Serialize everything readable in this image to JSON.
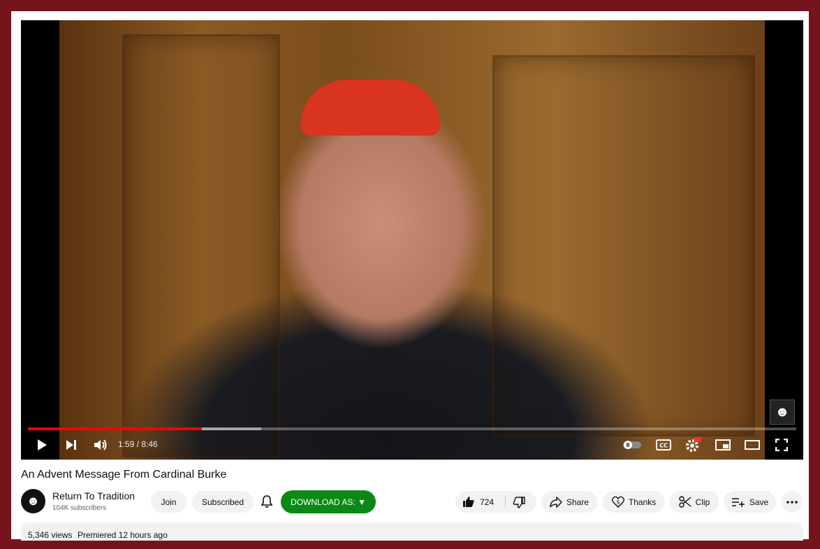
{
  "video": {
    "current_time": "1:59",
    "duration": "8:46",
    "time_display": "1:59 / 8:46",
    "progress_fraction": 0.226,
    "buffered_fraction": 0.304
  },
  "title": "An Advent Message From Cardinal Burke",
  "channel": {
    "name": "Return To Tradition",
    "subscribers": "104K subscribers"
  },
  "buttons": {
    "join": "Join",
    "subscribed": "Subscribed",
    "download": "DOWNLOAD AS: ▼",
    "likes": "724",
    "share": "Share",
    "thanks": "Thanks",
    "clip": "Clip",
    "save": "Save"
  },
  "description": {
    "views": "5,346 views",
    "premiered": "Premiered 12 hours ago"
  },
  "colors": {
    "frame": "#76141d",
    "progress": "#ff0000",
    "download": "#0a8a14"
  },
  "icons": [
    "play-icon",
    "next-icon",
    "volume-icon",
    "autoplay-toggle-icon",
    "captions-icon",
    "settings-icon",
    "hd-badge-icon",
    "miniplayer-icon",
    "theater-icon",
    "fullscreen-icon",
    "bell-icon",
    "like-icon",
    "dislike-icon",
    "share-icon",
    "thanks-icon",
    "clip-icon",
    "save-icon",
    "more-icon"
  ]
}
